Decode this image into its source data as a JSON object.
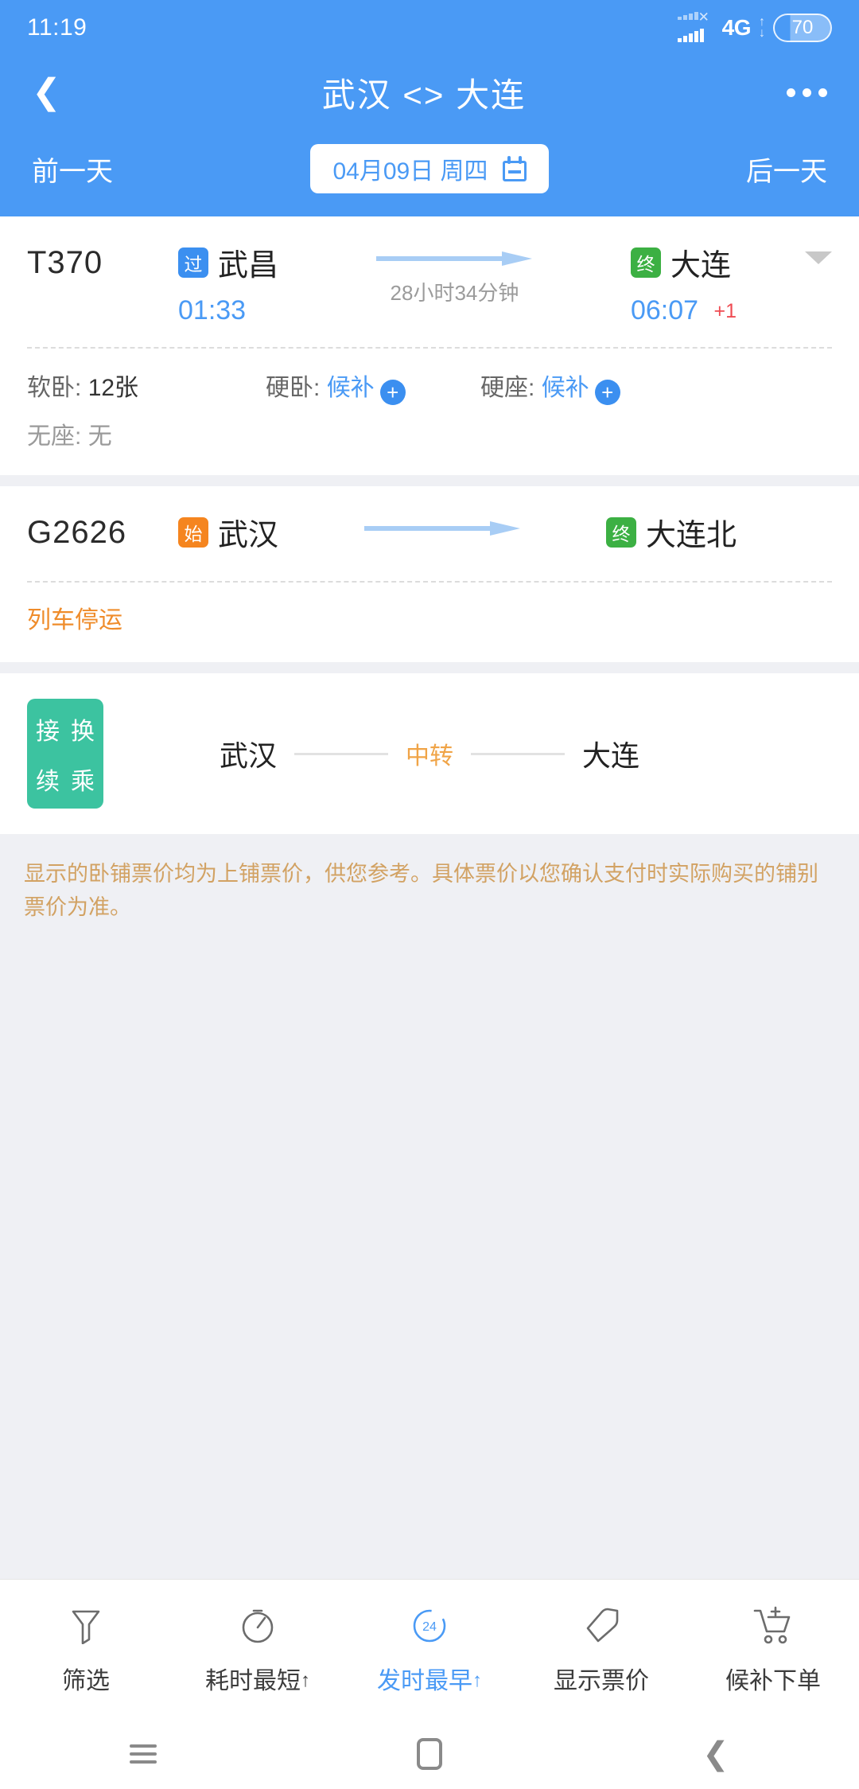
{
  "status_bar": {
    "clock": "11:19",
    "network": "4G",
    "battery": "70"
  },
  "header": {
    "back_icon": "chevron-left-icon",
    "title": "武汉 <> 大连",
    "more_icon": "more-options-icon",
    "prev_day": "前一天",
    "next_day": "后一天",
    "date": "04月09日 周四",
    "calendar_icon": "calendar-icon",
    "accent": "#4a9af5"
  },
  "trains": [
    {
      "number": "T370",
      "from_badge": "过",
      "from_badge_color": "#3b8ff0",
      "from_station": "武昌",
      "depart_time": "01:33",
      "duration": "28小时34分钟",
      "to_badge": "终",
      "to_badge_color": "#3cb043",
      "to_station": "大连",
      "arrive_time": "06:07",
      "day_offset": "+1",
      "expand_icon": "caret-down-icon",
      "seats": [
        {
          "label": "软卧:",
          "value": "12张",
          "state": "available"
        },
        {
          "label": "硬卧:",
          "value": "候补",
          "state": "waitlist"
        },
        {
          "label": "硬座:",
          "value": "候补",
          "state": "waitlist"
        },
        {
          "label": "无座:",
          "value": "无",
          "state": "none"
        }
      ]
    },
    {
      "number": "G2626",
      "from_badge": "始",
      "from_badge_color": "#f5851f",
      "from_station": "武汉",
      "to_badge": "终",
      "to_badge_color": "#3cb043",
      "to_station": "大连北",
      "status": "列车停运",
      "status_color": "#ef8c2b"
    }
  ],
  "transfer": {
    "badge_chars": [
      "接",
      "换",
      "续",
      "乘"
    ],
    "badge_color": "#3cc3a0",
    "from_station": "武汉",
    "mid_label": "中转",
    "to_station": "大连"
  },
  "notice": "显示的卧铺票价均为上铺票价，供您参考。具体票价以您确认支付时实际购买的铺别票价为准。",
  "toolbar": [
    {
      "label": "筛选",
      "icon": "funnel-icon",
      "active": false,
      "suffix": ""
    },
    {
      "label": "耗时最短",
      "icon": "stopwatch-icon",
      "active": false,
      "suffix": "↑"
    },
    {
      "label": "发时最早",
      "icon": "clock-24-icon",
      "active": true,
      "suffix": "↑"
    },
    {
      "label": "显示票价",
      "icon": "price-tag-icon",
      "active": false,
      "suffix": ""
    },
    {
      "label": "候补下单",
      "icon": "cart-plus-icon",
      "active": false,
      "suffix": ""
    }
  ],
  "navbar": {
    "recents_icon": "menu-icon",
    "home_icon": "home-square-icon",
    "back_icon": "back-chevron-icon"
  }
}
